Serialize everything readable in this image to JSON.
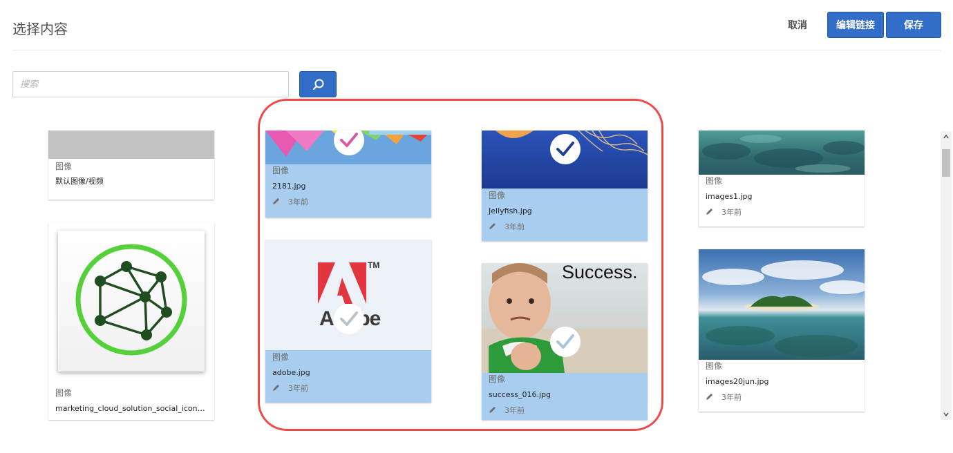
{
  "dialog": {
    "title": "选择内容",
    "cancel_label": "取消",
    "edit_link_label": "编辑链接",
    "save_label": "保存"
  },
  "search": {
    "placeholder": "搜索"
  },
  "cards": [
    {
      "type": "图像",
      "name": "默认图像/视频",
      "time": "",
      "selected": false
    },
    {
      "type": "图像",
      "name": "marketing_cloud_solution_social_icon_for...",
      "time": "",
      "selected": false
    },
    {
      "type": "图像",
      "name": "2181.jpg",
      "time": "3年前",
      "selected": true
    },
    {
      "type": "图像",
      "name": "adobe.jpg",
      "time": "3年前",
      "selected": true,
      "logo_text": "Adobe",
      "tm": "TM"
    },
    {
      "type": "图像",
      "name": "Jellyfish.jpg",
      "time": "3年前",
      "selected": true
    },
    {
      "type": "图像",
      "name": "success_016.jpg",
      "time": "3年前",
      "selected": true,
      "overlay_text": "Success."
    },
    {
      "type": "图像",
      "name": "images1.jpg",
      "time": "3年前",
      "selected": false
    },
    {
      "type": "图像",
      "name": "images20jun.jpg",
      "time": "3年前",
      "selected": false
    }
  ],
  "colors": {
    "primary": "#326ec8",
    "selected_card": "#a9cdee",
    "annotation": "#ee4b4b"
  }
}
